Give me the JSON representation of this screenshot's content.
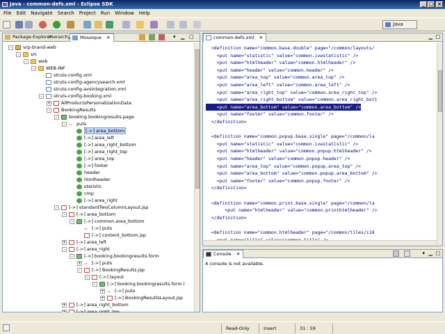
{
  "window": {
    "title": "Java - common-defs.xml - Eclipse SDK"
  },
  "menu": [
    "File",
    "Edit",
    "Navigate",
    "Search",
    "Project",
    "Run",
    "Window",
    "Help"
  ],
  "perspective": "Java",
  "left_tabs": [
    "Package Explorer",
    "Hierarchy",
    "Mosaique"
  ],
  "tree": [
    {
      "d": 0,
      "e": "-",
      "i": "proj",
      "t": "vrp-brand-web"
    },
    {
      "d": 1,
      "e": "-",
      "i": "folder",
      "t": "src"
    },
    {
      "d": 2,
      "e": "-",
      "i": "folder",
      "t": "web"
    },
    {
      "d": 3,
      "e": "-",
      "i": "folder",
      "t": "WEB-INF"
    },
    {
      "d": 4,
      "e": "",
      "i": "xml",
      "t": "struts-config.xml"
    },
    {
      "d": 4,
      "e": "",
      "i": "xml",
      "t": "struts-config-agencysearch.xml"
    },
    {
      "d": 4,
      "e": "",
      "i": "xml",
      "t": "struts-config-avsintegration.xml"
    },
    {
      "d": 4,
      "e": "-",
      "i": "xml",
      "t": "struts-config-booking.xml"
    },
    {
      "d": 5,
      "e": "+",
      "i": "f",
      "t": "AllProductsPersonalizationData"
    },
    {
      "d": 5,
      "e": "-",
      "i": "f",
      "t": "BookingResults"
    },
    {
      "d": 6,
      "e": "-",
      "i": "green-sq",
      "t": "booking.bookingresults.page"
    },
    {
      "d": 7,
      "e": "-",
      "i": "tag",
      "t": "puts"
    },
    {
      "d": 8,
      "e": "",
      "i": "green",
      "t": "[->] area_bottom",
      "sel": true
    },
    {
      "d": 8,
      "e": "",
      "i": "green",
      "t": "[->] area_left"
    },
    {
      "d": 8,
      "e": "",
      "i": "green",
      "t": "[->] area_right_bottom"
    },
    {
      "d": 8,
      "e": "",
      "i": "green",
      "t": "[->] area_right_top"
    },
    {
      "d": 8,
      "e": "",
      "i": "green",
      "t": "[->] area_top"
    },
    {
      "d": 8,
      "e": "",
      "i": "green",
      "t": "[->] footer"
    },
    {
      "d": 8,
      "e": "",
      "i": "green",
      "t": "header"
    },
    {
      "d": 8,
      "e": "",
      "i": "green",
      "t": "htmlheader"
    },
    {
      "d": 8,
      "e": "",
      "i": "green",
      "t": "statistic"
    },
    {
      "d": 8,
      "e": "",
      "i": "green",
      "t": "cmp"
    },
    {
      "d": 8,
      "e": "",
      "i": "green",
      "t": "[->] area_right"
    },
    {
      "d": 6,
      "e": "-",
      "i": "f",
      "t": "[->] standardTwoColumnLayout.jsp"
    },
    {
      "d": 7,
      "e": "-",
      "i": "f",
      "t": "[->] area_bottom"
    },
    {
      "d": 8,
      "e": "-",
      "i": "green-sq",
      "t": "[->] common.area_bottom"
    },
    {
      "d": 9,
      "e": "",
      "i": "tag",
      "t": "[->] puts"
    },
    {
      "d": 9,
      "e": "",
      "i": "f",
      "t": "[->] content_bottom.jsp"
    },
    {
      "d": 7,
      "e": "+",
      "i": "f",
      "t": "[->] area_left"
    },
    {
      "d": 7,
      "e": "-",
      "i": "f",
      "t": "[->] area_right"
    },
    {
      "d": 8,
      "e": "-",
      "i": "green-sq",
      "t": "[->] booking.bookingresults.form"
    },
    {
      "d": 9,
      "e": "+",
      "i": "tag",
      "t": "[->] puts"
    },
    {
      "d": 9,
      "e": "-",
      "i": "f",
      "t": "[->] BookingResults.jsp"
    },
    {
      "d": 10,
      "e": "-",
      "i": "f",
      "t": "[->] layout"
    },
    {
      "d": 11,
      "e": "-",
      "i": "green-sq",
      "t": "[->] booking.bookingresults.form.l"
    },
    {
      "d": 12,
      "e": "+",
      "i": "tag",
      "t": "[->] puts"
    },
    {
      "d": 12,
      "e": "+",
      "i": "f",
      "t": "[->] BookingResultsLayout.jsp"
    },
    {
      "d": 7,
      "e": "+",
      "i": "f",
      "t": "[->] area_right_bottom"
    },
    {
      "d": 7,
      "e": "+",
      "i": "f",
      "t": "[->] area_right_top"
    }
  ],
  "editor_tab": "common-defs.xml",
  "code": [
    {
      "t": "  <definition name=\"common.base.double\" page=\"/common/layouts/"
    },
    {
      "t": "    <put name=\"statistic\" value=\"common.ivwstatistic\" />"
    },
    {
      "t": "    <put name=\"htmlheader\" value=\"common.htmlheader\" />"
    },
    {
      "t": "    <put name=\"header\" value=\"common.header\" />"
    },
    {
      "t": "    <put name=\"area_top\" value=\"common.area_top\" />"
    },
    {
      "t": "    <put name=\"area_left\" value=\"common.area_left\" />"
    },
    {
      "t": "    <put name=\"area_right_top\" value=\"common.area_right_top\" />"
    },
    {
      "t": "    <put name=\"area_right_bottom\" value=\"common.area_right_bott"
    },
    {
      "t": "    <put name=\"area_bottom\" value=\"common.area_bottom\" />",
      "hl": true
    },
    {
      "t": "    <put name=\"footer\" value=\"common.footer\" />"
    },
    {
      "t": "  </definition>"
    },
    {
      "t": ""
    },
    {
      "t": "  <definition name=\"common.popup.base.single\" page=\"/common/la"
    },
    {
      "t": "    <put name=\"statistic\" value=\"common.ivwstatistic\" />"
    },
    {
      "t": "    <put name=\"htmlheader\" value=\"common.popup.htmlheader\" />"
    },
    {
      "t": "    <put name=\"header\" value=\"common.popup.header\" />"
    },
    {
      "t": "    <put name=\"area_top\" value=\"common.popup.area_top\" />"
    },
    {
      "t": "    <put name=\"area_bottom\" value=\"common.popup.area_bottom\" />"
    },
    {
      "t": "    <put name=\"footer\" value=\"common.popup.footer\" />"
    },
    {
      "t": "  </definition>"
    },
    {
      "t": ""
    },
    {
      "t": "  <definition name=\"common.print.base.single\" page=\"/common/la"
    },
    {
      "t": "       <put name=\"htmlheader\" value=\"common.printhtmlheader\" />"
    },
    {
      "t": "  </definition>"
    },
    {
      "t": ""
    },
    {
      "t": "  <definition name=\"common.htmlheader\" page=\"/common/tiles/i18"
    },
    {
      "t": "    <put name=\"title\" value=\"common.title\" />"
    }
  ],
  "console": {
    "tab": "Console",
    "message": "A console is not available."
  },
  "status": {
    "mode": "Read-Only",
    "insert": "Insert",
    "position": "31 : 59"
  }
}
